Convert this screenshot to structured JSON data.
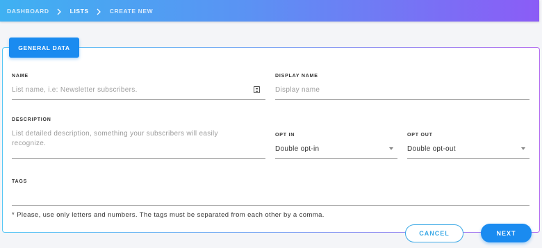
{
  "breadcrumb": {
    "items": [
      "DASHBOARD",
      "LISTS",
      "CREATE NEW"
    ]
  },
  "tab": {
    "label": "GENERAL DATA"
  },
  "form": {
    "name": {
      "label": "NAME",
      "placeholder": "List name, i.e: Newsletter subscribers."
    },
    "display_name": {
      "label": "DISPLAY NAME",
      "placeholder": "Display name"
    },
    "description": {
      "label": "DESCRIPTION",
      "placeholder_line1": "List detailed description, something your subscribers will easily",
      "placeholder_line2": "recognize."
    },
    "opt_in": {
      "label": "OPT IN",
      "value": "Double opt-in"
    },
    "opt_out": {
      "label": "OPT OUT",
      "value": "Double opt-out"
    },
    "tags": {
      "label": "TAGS",
      "hint": "* Please, use only letters and numbers. The tags must be separated from each other by a comma."
    }
  },
  "actions": {
    "cancel": "CANCEL",
    "next": "NEXT"
  },
  "colors": {
    "accent": "#1a8bf0",
    "gradient_start": "#3fb1f2",
    "gradient_end": "#8b5cf6"
  },
  "icons": {
    "chevron": "chevron-right-icon",
    "field_icon": "book-icon",
    "select": "caret-down-icon"
  }
}
